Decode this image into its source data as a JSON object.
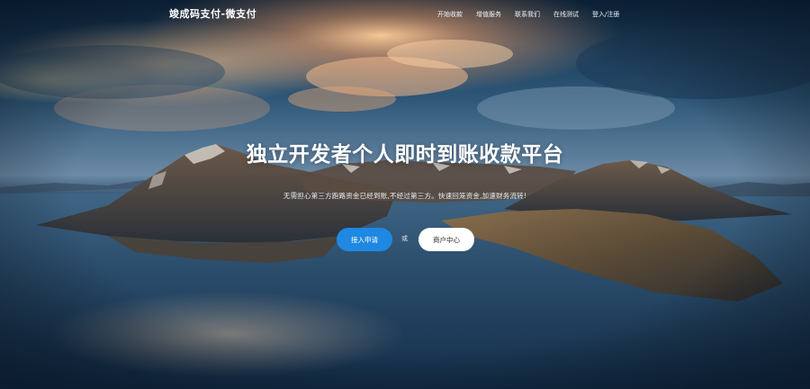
{
  "header": {
    "brand": "竣成码支付-微支付",
    "nav": [
      {
        "label": "开始收款"
      },
      {
        "label": "增值服务"
      },
      {
        "label": "联系我们"
      },
      {
        "label": "在线测试"
      },
      {
        "label": "登入/注册"
      }
    ]
  },
  "hero": {
    "title": "独立开发者个人即时到账收款平台",
    "subtitle": "无需担心第三方跑路资金已经到账,不经过第三方。快速回笼资金,加速财务流转!",
    "primary_button": "接入申请",
    "separator": "或",
    "secondary_button": "商户中心"
  },
  "colors": {
    "primary": "#1f88e2",
    "secondary_bg": "#ffffff",
    "text": "#ffffff"
  }
}
